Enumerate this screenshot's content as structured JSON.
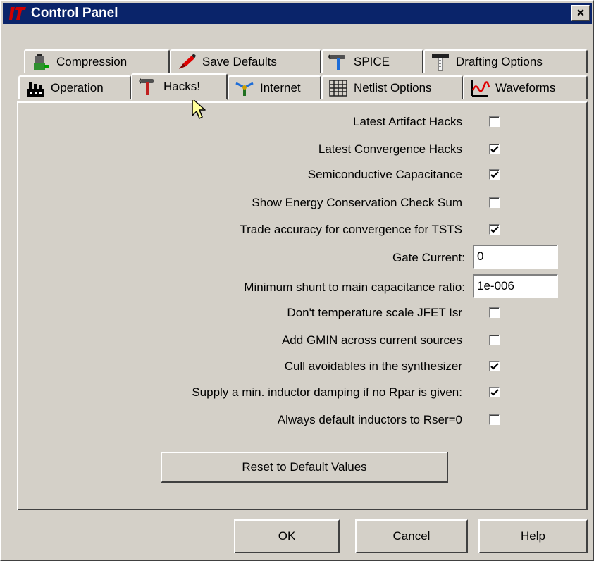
{
  "window": {
    "title": "Control Panel",
    "close_glyph": "×"
  },
  "tabs_back": [
    {
      "label": "Compression",
      "icon": "compression-clamp-icon"
    },
    {
      "label": "Save Defaults",
      "icon": "save-defaults-icon"
    },
    {
      "label": "SPICE",
      "icon": "spice-hammer-icon"
    },
    {
      "label": "Drafting Options",
      "icon": "drafting-icon"
    }
  ],
  "tabs_front": [
    {
      "label": "Operation",
      "icon": "factory-icon"
    },
    {
      "label": "Hacks!",
      "icon": "hammer-icon",
      "active": true
    },
    {
      "label": "Internet",
      "icon": "network-icon"
    },
    {
      "label": "Netlist Options",
      "icon": "netlist-grid-icon"
    },
    {
      "label": "Waveforms",
      "icon": "waveform-icon"
    }
  ],
  "options": [
    {
      "label": "Latest Artifact Hacks",
      "type": "checkbox",
      "checked": false
    },
    {
      "label": "Latest Convergence Hacks",
      "type": "checkbox",
      "checked": true
    },
    {
      "label": "Semiconductive Capacitance",
      "type": "checkbox",
      "checked": true
    },
    {
      "label": "Show Energy Conservation Check Sum",
      "type": "checkbox",
      "checked": false
    },
    {
      "label": "Trade accuracy for convergence for TSTS",
      "type": "checkbox",
      "checked": true
    },
    {
      "label": "Gate Current:",
      "type": "text",
      "value": "0"
    },
    {
      "label": "Minimum shunt to main capacitance ratio:",
      "type": "text",
      "value": "1e-006"
    },
    {
      "label": "Don't temperature scale JFET Isr",
      "type": "checkbox",
      "checked": false
    },
    {
      "label": "Add GMIN across current sources",
      "type": "checkbox",
      "checked": false
    },
    {
      "label": "Cull avoidables in the synthesizer",
      "type": "checkbox",
      "checked": true
    },
    {
      "label": "Supply a min. inductor damping if no Rpar is given:",
      "type": "checkbox",
      "checked": true
    },
    {
      "label": "Always default inductors to Rser=0",
      "type": "checkbox",
      "checked": false
    }
  ],
  "reset_button": "Reset to Default Values",
  "footer": {
    "ok": "OK",
    "cancel": "Cancel",
    "help": "Help"
  },
  "colors": {
    "titlebar": "#0a246a",
    "face": "#d4d0c8",
    "cursor": "#ffff99"
  }
}
